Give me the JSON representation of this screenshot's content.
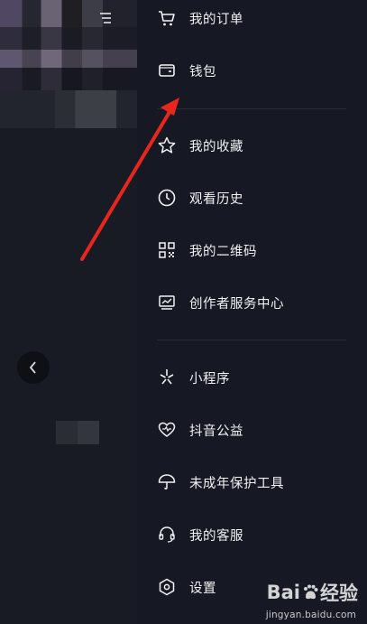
{
  "drawer": {
    "items": [
      {
        "label": "我的订单",
        "icon": "shopping-cart-icon"
      },
      {
        "label": "钱包",
        "icon": "wallet-icon"
      },
      {
        "label": "我的收藏",
        "icon": "star-icon"
      },
      {
        "label": "观看历史",
        "icon": "clock-icon"
      },
      {
        "label": "我的二维码",
        "icon": "qr-code-icon"
      },
      {
        "label": "创作者服务中心",
        "icon": "creator-chart-icon"
      },
      {
        "label": "小程序",
        "icon": "mini-program-icon"
      },
      {
        "label": "抖音公益",
        "icon": "heart-charity-icon"
      },
      {
        "label": "未成年保护工具",
        "icon": "umbrella-icon"
      },
      {
        "label": "我的客服",
        "icon": "headset-icon"
      },
      {
        "label": "设置",
        "icon": "settings-hexagon-icon"
      }
    ]
  },
  "watermark": {
    "logo_left": "Bai",
    "logo_right": "经验",
    "url": "jingyan.baidu.com"
  },
  "colors": {
    "background": "#161823",
    "text": "#f2f2f2",
    "arrow": "#e8261e"
  }
}
